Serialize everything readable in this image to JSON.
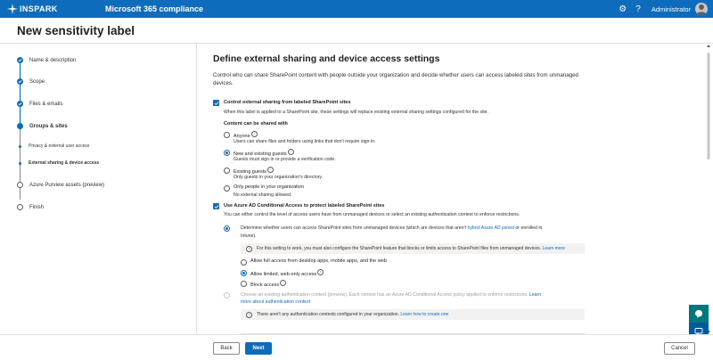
{
  "topbar": {
    "brand": "INSPARK",
    "app_title": "Microsoft 365 compliance",
    "user_name": "Administrator",
    "icons": [
      "gear-icon",
      "help-icon",
      "avatar"
    ]
  },
  "page_title": "New sensitivity label",
  "nav": {
    "steps": [
      {
        "label": "Name & description",
        "state": "done"
      },
      {
        "label": "Scope",
        "state": "done"
      },
      {
        "label": "Files & emails",
        "state": "done"
      },
      {
        "label": "Groups & sites",
        "state": "current"
      },
      {
        "label": "Azure Purview assets (preview)",
        "state": "todo"
      },
      {
        "label": "Finish",
        "state": "todo"
      }
    ],
    "substeps": [
      {
        "label": "Privacy & external user access",
        "active": false
      },
      {
        "label": "External sharing & device access",
        "active": true
      }
    ]
  },
  "content": {
    "heading": "Define external sharing and device access settings",
    "description": "Control who can share SharePoint content with people outside your organization and decide whether users can access labeled sites from unmanaged devices.",
    "sharing": {
      "checkbox_label": "Control external sharing from labeled SharePoint sites",
      "checkbox_desc": "When this label is applied to a SharePoint site, these settings will replace existing external sharing settings configured for the site.",
      "group_label": "Content can be shared with",
      "options": [
        {
          "label": "Anyone",
          "desc": "Users can share files and folders using links that don't require sign-in.",
          "checked": false
        },
        {
          "label": "New and existing guests",
          "desc": "Guests must sign in or provide a verification code.",
          "checked": true
        },
        {
          "label": "Existing guests",
          "desc": "Only guests in your organization's directory.",
          "checked": false
        },
        {
          "label": "Only people in your organization",
          "desc": "No external sharing allowed.",
          "checked": false
        }
      ]
    },
    "conditional": {
      "checkbox_label": "Use Azure AD Conditional Access to protect labeled SharePoint sites",
      "checkbox_desc": "You can either control the level of access users have from unmanaged devices or select an existing authentication context to enforce restrictions.",
      "option1_text_a": "Determine whether users can access SharePoint sites from unmanaged devices (which are devices that aren't",
      "option1_link": "hybrid Azure AD joined",
      "option1_text_b": "or enrolled in",
      "option1_text_c": "Intune).",
      "info1_text": "For this setting to work, you must also configure the SharePoint feature that blocks or limits access to SharePoint files from unmanaged devices.",
      "info1_link": "Learn more",
      "access_options": [
        {
          "label": "Allow full access from desktop apps, mobile apps, and the web",
          "checked": false
        },
        {
          "label": "Allow limited, web-only access",
          "checked": true
        },
        {
          "label": "Block access",
          "checked": false
        }
      ],
      "option2_text_a": "Choose an existing authentication context (preview). Each context has an Azure AD Conditional Access policy applied to enforce restrictions.",
      "option2_link_a": "Learn",
      "option2_link_b": "more about authentication context",
      "info2_text": "There aren't any authentication contexts configured in your organization.",
      "info2_link": "Learn how to create one"
    }
  },
  "footer": {
    "back_label": "Back",
    "next_label": "Next",
    "cancel_label": "Cancel"
  },
  "colors": {
    "accent": "#0f6cbd",
    "teal": "#03787c"
  }
}
